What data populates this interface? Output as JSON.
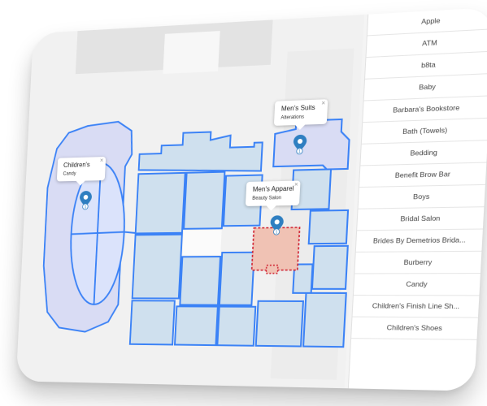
{
  "map": {
    "popups": [
      {
        "title": "Children's",
        "subtitle": "Candy",
        "pin_count": "1"
      },
      {
        "title": "Men's Suits",
        "subtitle": "Alterations",
        "pin_count": "1"
      },
      {
        "title": "Men's Apparel",
        "subtitle": "Beauty Salon",
        "pin_count": "1"
      }
    ],
    "close_glyph": "×",
    "colors": {
      "store_fill": "#cfe0ee",
      "store_stroke": "#3b82f6",
      "anchor_fill": "#d9dcf4",
      "highlight_fill": "#f0c2b4",
      "highlight_stroke": "#d0202f",
      "pin": "#2f7fc1"
    }
  },
  "directory": {
    "items": [
      "Apple",
      "ATM",
      "b8ta",
      "Baby",
      "Barbara's Bookstore",
      "Bath (Towels)",
      "Bedding",
      "Benefit Brow Bar",
      "Boys",
      "Bridal Salon",
      "Brides By Demetrios Brida...",
      "Burberry",
      "Candy",
      "Children's Finish Line Sh...",
      "Children's Shoes"
    ]
  }
}
